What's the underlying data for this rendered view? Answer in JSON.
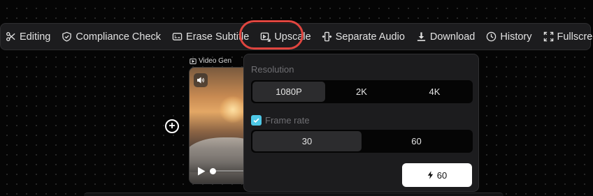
{
  "toolbar": {
    "items": [
      {
        "label": "Editing",
        "icon": "scissors-icon"
      },
      {
        "label": "Compliance Check",
        "icon": "shield-check-icon"
      },
      {
        "label": "Erase Subtitle",
        "icon": "subtitle-icon"
      },
      {
        "label": "Upscale",
        "icon": "upscale-icon"
      },
      {
        "label": "Separate Audio",
        "icon": "split-audio-icon"
      },
      {
        "label": "Download",
        "icon": "download-icon"
      },
      {
        "label": "History",
        "icon": "clock-icon"
      },
      {
        "label": "Fullscreen",
        "icon": "fullscreen-icon"
      }
    ],
    "highlighted": "Upscale",
    "highlight_color": "#e0453f"
  },
  "node": {
    "label": "Video Gen"
  },
  "upscale_panel": {
    "resolution": {
      "title": "Resolution",
      "options": [
        "1080P",
        "2K",
        "4K"
      ],
      "selected": "1080P"
    },
    "frame_rate": {
      "label": "Frame rate",
      "checked": true,
      "options": [
        "30",
        "60"
      ],
      "selected": "30"
    },
    "submit": {
      "cost": "60",
      "icon": "lightning-icon"
    },
    "accent_color": "#4ec8e6"
  }
}
